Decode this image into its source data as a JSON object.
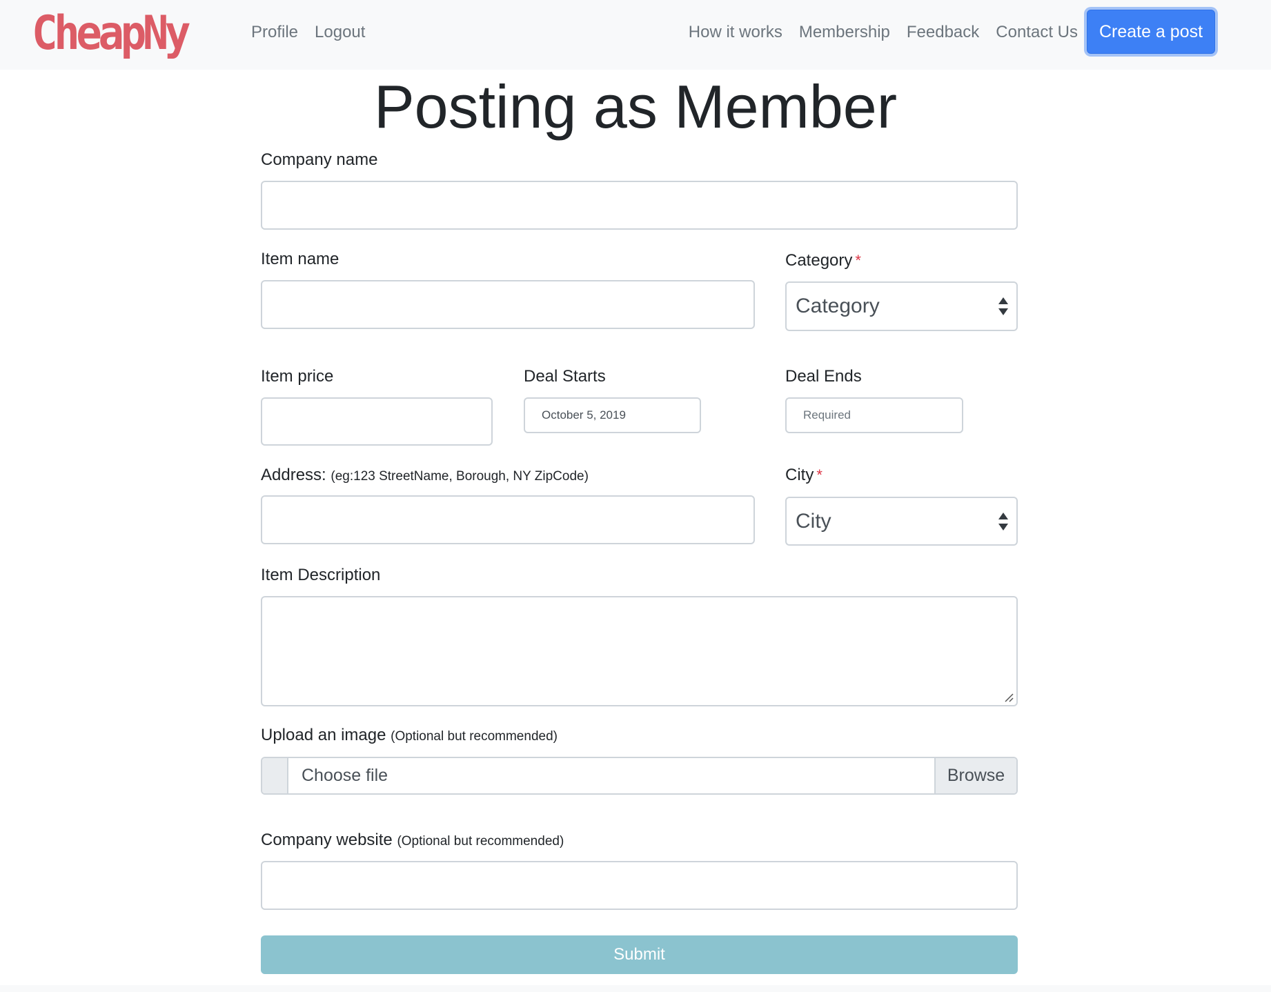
{
  "nav": {
    "brand": "CheapNy",
    "left_links": [
      "Profile",
      "Logout"
    ],
    "right_links": [
      "How it works",
      "Membership",
      "Feedback",
      "Contact Us"
    ],
    "create_button": "Create a post"
  },
  "colors": {
    "brand": "#dc5c66",
    "primary": "#3d80f5",
    "submit": "#8bc3cf",
    "required": "#dc3545"
  },
  "page": {
    "title": "Posting as Member"
  },
  "form": {
    "company_name": {
      "label": "Company name",
      "value": ""
    },
    "item_name": {
      "label": "Item name",
      "value": ""
    },
    "category": {
      "label": "Category",
      "required_mark": "*",
      "selected": "Category"
    },
    "item_price": {
      "label": "Item price",
      "value": ""
    },
    "deal_starts": {
      "label": "Deal Starts",
      "value": "October 5, 2019"
    },
    "deal_ends": {
      "label": "Deal Ends",
      "placeholder": "Required"
    },
    "address": {
      "label": "Address:",
      "hint": "(eg:123 StreetName, Borough, NY ZipCode)",
      "value": ""
    },
    "city": {
      "label": "City",
      "required_mark": "*",
      "selected": "City"
    },
    "description": {
      "label": "Item Description",
      "value": ""
    },
    "upload": {
      "label": "Upload an image",
      "hint": "(Optional but recommended)",
      "file_text": "Choose file",
      "browse": "Browse"
    },
    "website": {
      "label": "Company website",
      "hint": "(Optional but recommended)",
      "value": ""
    },
    "submit": "Submit"
  },
  "icons": {
    "select_arrows": "up-down-arrows-icon",
    "resize": "resize-grip-icon"
  }
}
